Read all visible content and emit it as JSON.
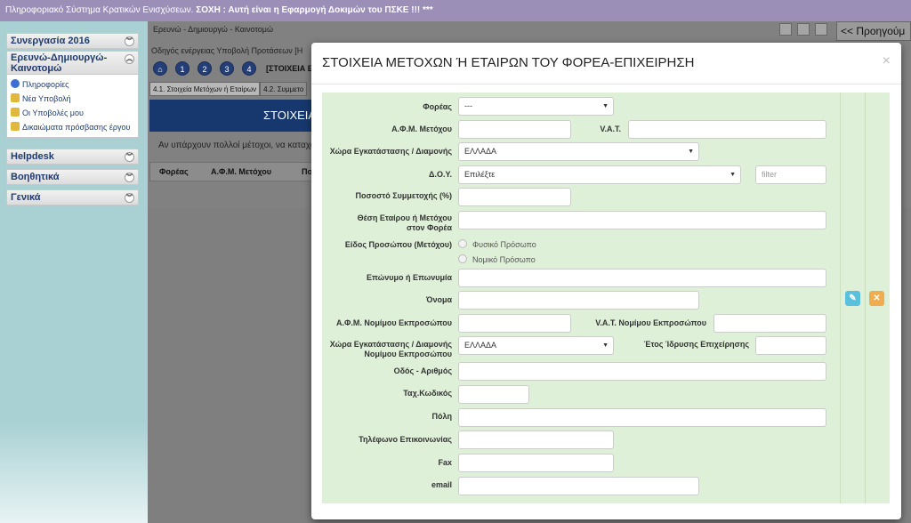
{
  "topbar": {
    "prefix": "Πληροφοριακό Σύστημα Κρατικών Ενισχύσεων. ",
    "warning": "ΣΟΧΗ : Αυτή είναι η Εφαρμογή Δοκιμών του ΠΣΚΕ !!! ***"
  },
  "sidebar": {
    "sections": [
      {
        "label": "Συνεργασία 2016"
      },
      {
        "label": "Ερευνώ-Δημιουργώ-Καινοτομώ"
      },
      {
        "label": "Helpdesk"
      },
      {
        "label": "Βοηθητικά"
      },
      {
        "label": "Γενικά"
      }
    ],
    "items": [
      {
        "label": "Πληροφορίες",
        "icon": "info-icon",
        "color": "#3b6fd1"
      },
      {
        "label": "Νέα Υποβολή",
        "icon": "folder-new-icon",
        "color": "#e0b93a"
      },
      {
        "label": "Οι Υποβολές μου",
        "icon": "folder-icon",
        "color": "#e0b93a"
      },
      {
        "label": "Δικαιώματα πρόσβασης έργου",
        "icon": "key-folder-icon",
        "color": "#e0b93a"
      }
    ]
  },
  "background": {
    "breadcrumb": "Ερευνώ - Δημιουργώ - Καινοτομώ",
    "wizard_text": "Οδηγός ενέργειας Υποβολή Προτάσεων [Η",
    "steps": [
      "1",
      "2",
      "3",
      "4"
    ],
    "step_label": "[ΣΤΟΙΧΕΙΑ Ε",
    "tabs": [
      "4.1. Στοιχεία Μετόχων ή Εταίρων",
      "4.2. Συμμετο"
    ],
    "banner": "ΣΤΟΙΧΕΙΑ",
    "info_line": "Αν υπάρχουν πολλοί μέτοχοι, να καταχω",
    "grid_headers": [
      "Φορέας",
      "Α.Φ.Μ. Μετόχου",
      "Πο"
    ],
    "prev_button": "<< Προηγούμ"
  },
  "modal": {
    "title": "ΣΤΟΙΧΕΙΑ ΜΕΤΟΧΩΝ Ή ΕΤΑΙΡΩΝ ΤΟΥ ΦΟΡΕΑ-ΕΠΙΧΕΙΡΗΣΗ",
    "close": "×",
    "labels": {
      "foreas": "Φορέας",
      "afm_metoxou": "Α.Φ.Μ. Μετόχου",
      "vat": "V.A.T.",
      "xwra": "Χώρα Εγκατάστασης / Διαμονής",
      "doy": "Δ.Ο.Υ.",
      "pososto": "Ποσοστό Συμμετοχής (%)",
      "thesi": "Θέση Εταίρου ή Μετόχου στον Φορέα",
      "eidos": "Είδος Προσώπου (Μετόχου)",
      "eponymo": "Επώνυμο ή Επωνυμία",
      "onoma": "Όνομα",
      "afm_nomimou": "Α.Φ.Μ. Νομίμου Εκπροσώπου",
      "vat_nomimou": "V.A.T. Νομίμου Εκπροσώπου",
      "xwra_nomimou": "Χώρα Εγκατάστασης / Διαμονής Νομίμου Εκπροσώπου",
      "etos": "Έτος Ίδρυσης Επιχείρησης",
      "odos": "Οδός - Αριθμός",
      "tk": "Ταχ.Κωδικός",
      "poli": "Πόλη",
      "tilefono": "Τηλέφωνο Επικοινωνίας",
      "fax": "Fax",
      "email": "email"
    },
    "values": {
      "foreas": "---",
      "xwra": "ΕΛΛΑΔΑ",
      "doy": "Επιλέξτε",
      "xwra_nomimou": "ΕΛΛΑΔΑ"
    },
    "placeholders": {
      "filter": "filter"
    },
    "radios": [
      "Φυσικό Πρόσωπο",
      "Νομικό Πρόσωπο"
    ]
  }
}
